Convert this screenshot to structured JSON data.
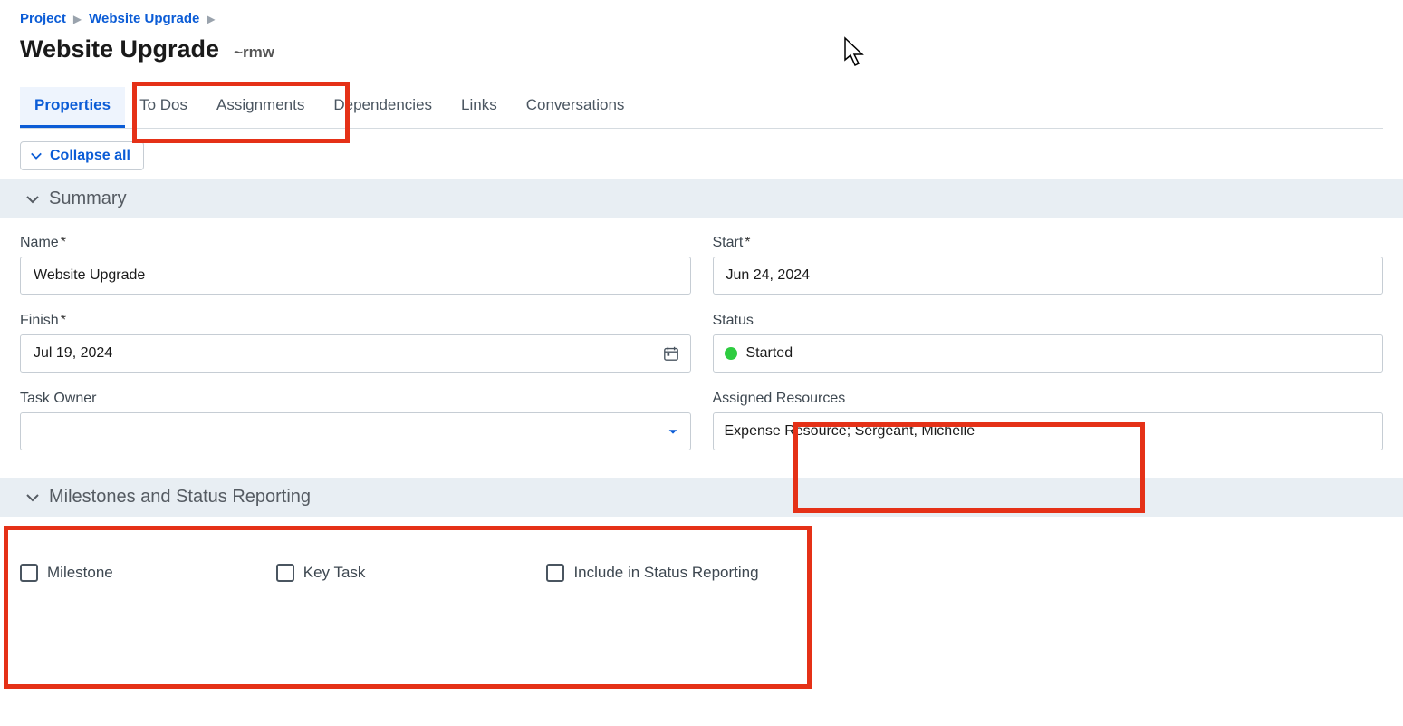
{
  "breadcrumb": {
    "item1": "Project",
    "item2": "Website Upgrade"
  },
  "title": "Website Upgrade",
  "owner_tag": "~rmw",
  "tabs": {
    "properties": "Properties",
    "todos": "To Dos",
    "assignments": "Assignments",
    "dependencies": "Dependencies",
    "links": "Links",
    "conversations": "Conversations"
  },
  "collapse_all": "Collapse all",
  "sections": {
    "summary": "Summary",
    "milestones": "Milestones and Status Reporting"
  },
  "fields": {
    "name_label": "Name",
    "name_value": "Website Upgrade",
    "start_label": "Start",
    "start_value": "Jun 24, 2024",
    "finish_label": "Finish",
    "finish_value": "Jul 19, 2024",
    "status_label": "Status",
    "status_value": "Started",
    "status_color": "#2ecc40",
    "task_owner_label": "Task Owner",
    "task_owner_value": "",
    "assigned_resources_label": "Assigned Resources",
    "assigned_resources_value": "Expense Resource; Sergeant, Michelle"
  },
  "checkboxes": {
    "milestone": "Milestone",
    "key_task": "Key Task",
    "include_status": "Include in Status Reporting"
  },
  "required_marker": "*"
}
